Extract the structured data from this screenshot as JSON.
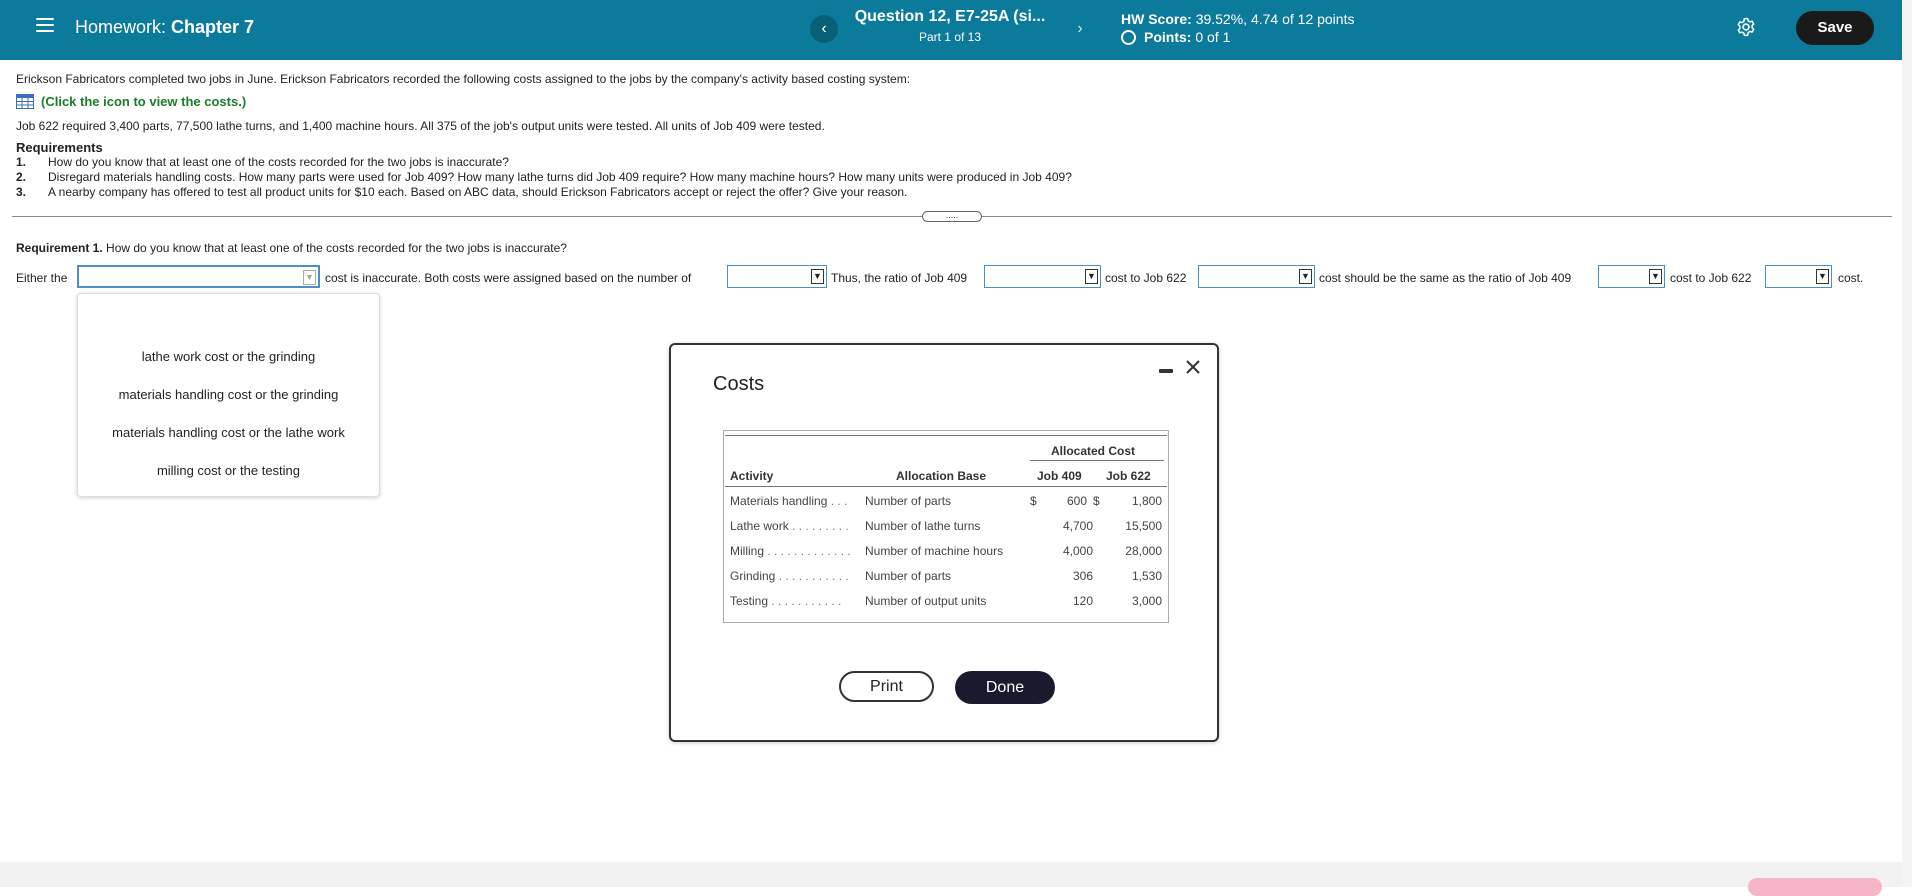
{
  "header": {
    "homework_prefix": "Homework:",
    "homework_name": "Chapter 7",
    "prev_label": "‹",
    "next_label": "›",
    "question_title": "Question 12, E7-25A (si...",
    "question_part": "Part 1 of 13",
    "score_label": "HW Score:",
    "score_value": "39.52%, 4.74 of 12 points",
    "points_label": "Points:",
    "points_value": "0 of 1",
    "save_label": "Save"
  },
  "problem": {
    "intro": "Erickson Fabricators completed two jobs in June. Erickson Fabricators recorded the following costs assigned to the jobs by the company's activity based costing system:",
    "link_text": "(Click the icon to view the costs.)",
    "job_info": "Job 622 required 3,400 parts, 77,500 lathe turns, and 1,400 machine hours. All 375 of the job's output units were tested. All units of Job 409 were tested.",
    "requirements_heading": "Requirements",
    "requirements": [
      {
        "num": "1.",
        "text": "How do you know that at least one of the costs recorded for the two jobs is inaccurate?"
      },
      {
        "num": "2.",
        "text": "Disregard materials handling costs. How many parts were used for Job 409? How many lathe turns did Job 409 require? How many machine hours? How many units were produced in Job 409?"
      },
      {
        "num": "3.",
        "text": "A nearby company has offered to test all product units for $10 each. Based on ABC data, should Erickson Fabricators accept or reject the offer? Give your reason."
      }
    ],
    "expander_label": "....."
  },
  "requirement1": {
    "label": "Requirement 1.",
    "question": "How do you know that at least one of the costs recorded for the two jobs is inaccurate?",
    "either_the": "Either the",
    "seg2": "cost is inaccurate. Both costs were assigned based on the number of",
    "seg3": "Thus, the ratio of Job 409",
    "seg4": "cost to Job 622",
    "seg5": "cost should be the same as the ratio of Job 409",
    "seg6": "cost to Job 622",
    "seg7": "cost.",
    "arrow": "▼",
    "dropdown_options": [
      "lathe work cost or the grinding",
      "materials handling cost or the grinding",
      "materials handling cost or the lathe work",
      "milling cost or the testing"
    ]
  },
  "modal": {
    "title": "Costs",
    "col_allocated_cost": "Allocated Cost",
    "col_activity": "Activity",
    "col_base": "Allocation Base",
    "col_job409": "Job 409",
    "col_job622": "Job 622",
    "rows": [
      {
        "activity": "Materials handling",
        "dots": " . . .",
        "base": "Number of parts",
        "d1": "$",
        "j409": "600",
        "d2": "$",
        "j622": "1,800"
      },
      {
        "activity": "Lathe work",
        "dots": " . . . . . . . . .",
        "base": "Number of lathe turns",
        "d1": "",
        "j409": "4,700",
        "d2": "",
        "j622": "15,500"
      },
      {
        "activity": "Milling",
        "dots": " . . . . . . . . . . . . .",
        "base": "Number of machine hours",
        "d1": "",
        "j409": "4,000",
        "d2": "",
        "j622": "28,000"
      },
      {
        "activity": "Grinding",
        "dots": " . . . . . . . . . . .",
        "base": "Number of parts",
        "d1": "",
        "j409": "306",
        "d2": "",
        "j622": "1,530"
      },
      {
        "activity": "Testing",
        "dots": " . . . . . . . . . . .",
        "base": "Number of output units",
        "d1": "",
        "j409": "120",
        "d2": "",
        "j622": "3,000"
      }
    ],
    "print_label": "Print",
    "done_label": "Done"
  },
  "colors": {
    "header_bg": "#0c7a9b",
    "link_green": "#1a7d2a",
    "dropdown_border": "#4a8ed0",
    "dark_button": "#1a1a2e"
  }
}
